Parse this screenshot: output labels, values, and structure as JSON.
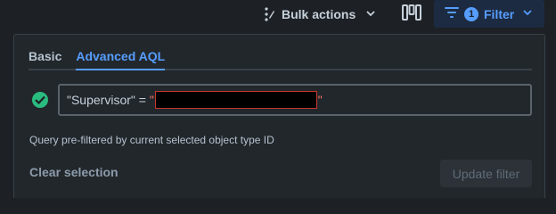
{
  "toolbar": {
    "bulk_actions_label": "Bulk actions",
    "filter_label": "Filter",
    "filter_count": "1"
  },
  "panel": {
    "tabs": [
      {
        "label": "Basic",
        "active": false
      },
      {
        "label": "Advanced AQL",
        "active": true
      }
    ],
    "query": {
      "prefix": "\"Supervisor\" = ",
      "open_quote": "\"",
      "close_quote": "\"",
      "valid": true
    },
    "hint": "Query pre-filtered by current selected object type ID",
    "clear_label": "Clear selection",
    "update_label": "Update filter"
  },
  "colors": {
    "background": "#1d2125",
    "panel": "#22272b",
    "accent": "#579dff",
    "success": "#2abb7f",
    "danger": "#c9372c"
  },
  "icons": [
    "kebab-icon",
    "chevron-down-icon",
    "columns-icon",
    "filter-icon",
    "check-circle-icon"
  ]
}
